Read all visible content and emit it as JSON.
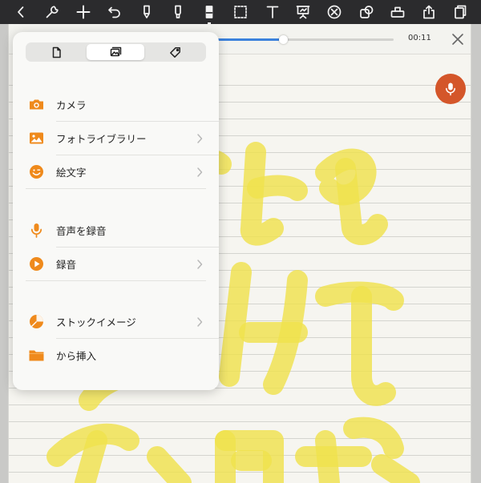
{
  "toolbar": {
    "tools": [
      {
        "name": "back",
        "icon": "chevron-left-icon"
      },
      {
        "name": "settings",
        "icon": "wrench-icon"
      },
      {
        "name": "add",
        "icon": "plus-icon"
      },
      {
        "name": "undo",
        "icon": "undo-icon"
      },
      {
        "name": "pen",
        "icon": "pen-icon"
      },
      {
        "name": "highlighter",
        "icon": "highlighter-icon"
      },
      {
        "name": "eraser",
        "icon": "eraser-icon",
        "active": true
      },
      {
        "name": "lasso",
        "icon": "lasso-icon"
      },
      {
        "name": "text",
        "icon": "text-icon"
      },
      {
        "name": "presentation",
        "icon": "presentation-icon"
      },
      {
        "name": "laser",
        "icon": "laser-icon"
      },
      {
        "name": "shapes",
        "icon": "shapes-icon"
      },
      {
        "name": "tape",
        "icon": "tape-icon"
      },
      {
        "name": "share",
        "icon": "share-icon"
      },
      {
        "name": "pages",
        "icon": "pages-icon"
      }
    ]
  },
  "audio": {
    "time": "00:11",
    "progress": 0.4
  },
  "colors": {
    "accent_orange": "#ef8a1c",
    "mic_fab": "#d4562a",
    "progress_blue": "#3c82dc",
    "ink_yellow": "#efe24d"
  },
  "popover": {
    "tabs": [
      {
        "name": "document",
        "icon": "document-icon",
        "selected": false
      },
      {
        "name": "image",
        "icon": "image-icon",
        "selected": true
      },
      {
        "name": "sticker",
        "icon": "tag-icon",
        "selected": false
      }
    ],
    "items": [
      {
        "label": "カメラ",
        "icon": "camera-icon",
        "chevron": false
      },
      {
        "label": "フォトライブラリー",
        "icon": "photo-library-icon",
        "chevron": true
      },
      {
        "label": "絵文字",
        "icon": "emoji-icon",
        "chevron": true
      },
      {
        "label": "音声を録音",
        "icon": "microphone-icon",
        "chevron": false
      },
      {
        "label": "録音",
        "icon": "play-circle-icon",
        "chevron": true
      },
      {
        "label": "ストックイメージ",
        "icon": "stock-image-icon",
        "chevron": true
      },
      {
        "label": "から挿入",
        "icon": "folder-icon",
        "chevron": false
      }
    ]
  }
}
